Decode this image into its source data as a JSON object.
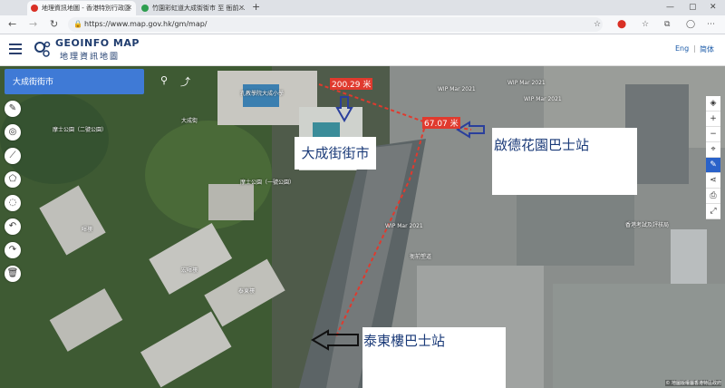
{
  "browser": {
    "tabs": [
      {
        "title": "地理資訊地圖 - 香港特別行政區",
        "active": true,
        "favicon_color": "#d93025"
      },
      {
        "title": "竹園彩虹道大成街街市 至 衙前…",
        "active": false,
        "favicon_color": "#2e9e4f"
      }
    ],
    "new_tab_label": "+",
    "url": "https://www.map.gov.hk/gm/map/"
  },
  "app": {
    "logo_en": "GEOINFO MAP",
    "logo_zh": "地理資訊地圖",
    "lang_en": "Eng",
    "lang_sep": "|",
    "lang_sc": "简体"
  },
  "search": {
    "query": "大成街街市"
  },
  "annotations": {
    "market": "大成街街市",
    "kai_tak_stop": "啟德花園巴士站",
    "tai_tung_stop": "泰東樓巴士站",
    "dist1": "200.29 米",
    "dist2": "67.07 米"
  },
  "map_labels": [
    "孔教學院大成小學",
    "WIP Mar 2021",
    "WIP Mar 2021",
    "WIP Mar 2021",
    "WIP Mar 2021",
    "摩士公園（二號公園）",
    "摩士公園（一號公園）",
    "香港考試及評核局",
    "泰東樓",
    "大成街",
    "暉樓",
    "宏暉樓",
    "衙前塱道"
  ],
  "attribution": "© 地圖版權屬香港特區政府",
  "colors": {
    "accent": "#3f7ad6",
    "route": "#e03a2e",
    "annotation_text": "#1a3a78"
  }
}
